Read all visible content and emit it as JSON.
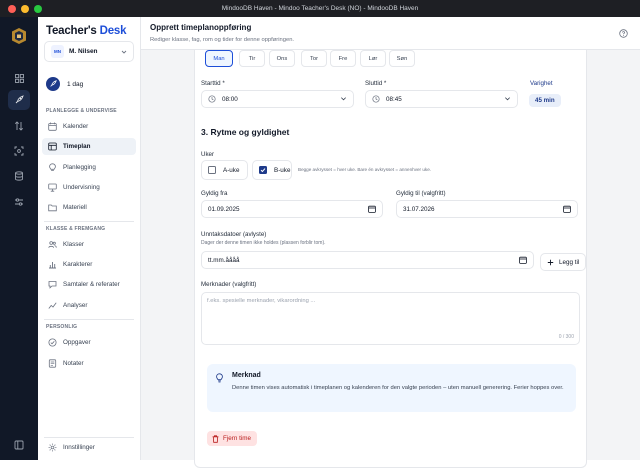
{
  "window": {
    "title": "MindooDB Haven - Mindoo Teacher's Desk (NO) - MindooDB Haven",
    "colors": {
      "close": "#ff5f57",
      "minimize": "#febc2e",
      "maximize": "#28c840",
      "accent": "#1d4ed8",
      "rail": "#111827"
    }
  },
  "rail": {
    "icons": [
      "app-logo-icon",
      "grid-icon",
      "rocket-icon",
      "arrows-updown-icon",
      "scan-icon",
      "database-icon",
      "sliders-icon",
      "panel-toggle-icon"
    ]
  },
  "sidebar": {
    "brand_main": "Teacher's ",
    "brand_accent": "Desk",
    "user": {
      "initials": "MN",
      "name": "M. Nilsen"
    },
    "streak": "1 dag",
    "sections": {
      "plan": "PLANLEGGE & UNDERVISE",
      "class": "KLASSE & FREMGANG",
      "personal": "PERSONLIG"
    },
    "items": {
      "kalender": "Kalender",
      "timeplan": "Timeplan",
      "planlegging": "Planlegging",
      "undervisning": "Undervisning",
      "materiell": "Materiell",
      "klasser": "Klasser",
      "karakterer": "Karakterer",
      "samtaler": "Samtaler & referater",
      "analyser": "Analyser",
      "oppgaver": "Oppgaver",
      "notater": "Notater",
      "innstillinger": "Innstillinger"
    }
  },
  "header": {
    "title": "Opprett timeplanoppføring",
    "subtitle": "Rediger klasse, fag, rom og tider for denne oppføringen."
  },
  "form": {
    "days": [
      "Man",
      "Tir",
      "Ons",
      "Tor",
      "Fre",
      "Lør",
      "Søn"
    ],
    "selected_day": "Man",
    "start_label": "Starttid *",
    "start_value": "08:00",
    "end_label": "Sluttid *",
    "end_value": "08:45",
    "duration_label": "Varighet",
    "duration_value": "45 min",
    "section3_title": "3. Rytme og gyldighet",
    "weeks_label": "Uker",
    "a_week": "A-uke",
    "a_week_checked": false,
    "b_week": "B-uke",
    "b_week_checked": true,
    "weeks_hint": "Begge avkrysset = hver uke. Bare én avkrysset = annenhver uke.",
    "valid_from_label": "Gyldig fra",
    "valid_from_value": "01.09.2025",
    "valid_to_label": "Gyldig til (valgfritt)",
    "valid_to_value": "31.07.2026",
    "exceptions_label": "Unntaksdatoer (avlyste)",
    "exceptions_hint": "Dager der denne timen ikke holdes (plassen forblir tom).",
    "exception_date_value": "tt.mm.åååå",
    "add_button": "Legg til",
    "notes_label": "Merknader (valgfritt)",
    "notes_placeholder": "f.eks. spesielle merknader, vikarordning ...",
    "notes_count": "0 / 300",
    "info_title": "Merknad",
    "info_text": "Denne timen vises automatisk i timeplanen og kalenderen for den valgte perioden – uten manuell generering. Ferier hoppes over.",
    "delete_button": "Fjern time"
  }
}
